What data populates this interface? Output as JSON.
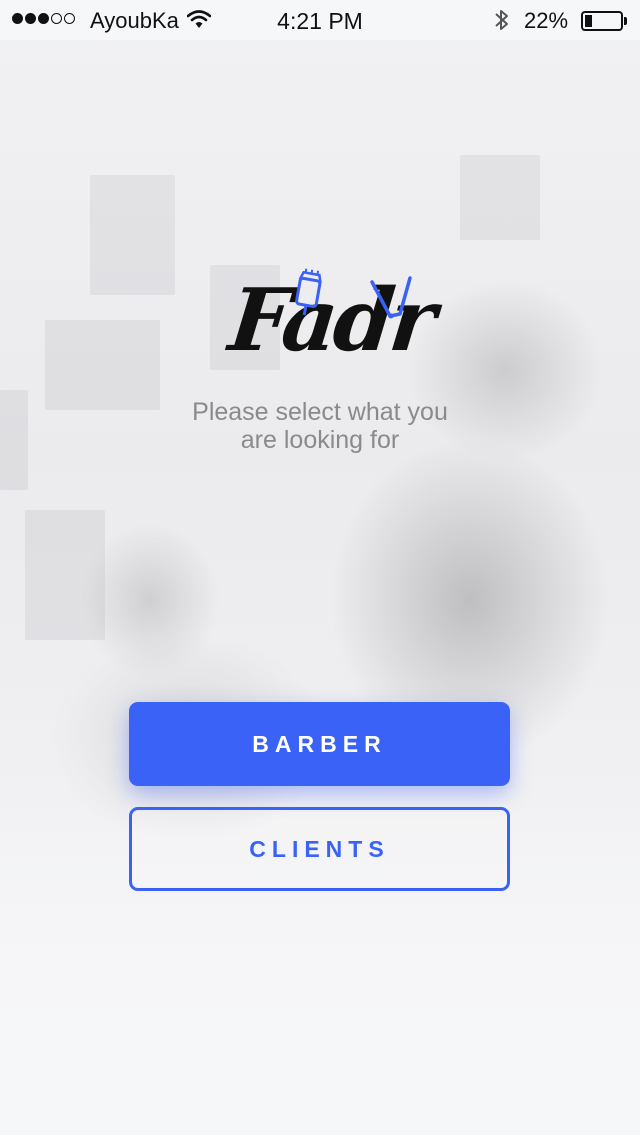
{
  "status_bar": {
    "carrier": "AyoubKa",
    "time": "4:21 PM",
    "battery_percent": "22%",
    "battery_level": 0.22,
    "signal_bars_filled": 3,
    "signal_bars_total": 5
  },
  "logo": {
    "text": "Fadr"
  },
  "subtitle": {
    "line1": "Please select what you",
    "line2": "are looking for"
  },
  "buttons": {
    "barber_label": "BARBER",
    "clients_label": "CLIENTS"
  },
  "colors": {
    "accent": "#3a62f7",
    "subtitle": "#8a8a8e",
    "background": "#f6f7f9"
  },
  "icons": [
    "wifi-icon",
    "bluetooth-icon",
    "battery-icon",
    "hair-clipper-icon",
    "straight-razor-icon"
  ]
}
